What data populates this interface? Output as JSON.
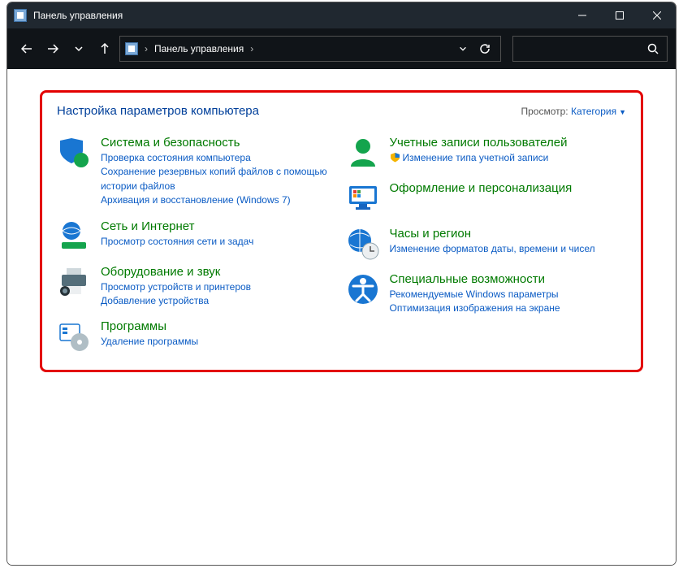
{
  "titlebar": {
    "title": "Панель управления"
  },
  "breadcrumb": {
    "root": "Панель управления"
  },
  "panel": {
    "title": "Настройка параметров компьютера",
    "view_label": "Просмотр:",
    "view_value": "Категория"
  },
  "left": [
    {
      "title": "Система и безопасность",
      "links": [
        "Проверка состояния компьютера",
        "Сохранение резервных копий файлов с помощью истории файлов",
        "Архивация и восстановление (Windows 7)"
      ]
    },
    {
      "title": "Сеть и Интернет",
      "links": [
        "Просмотр состояния сети и задач"
      ]
    },
    {
      "title": "Оборудование и звук",
      "links": [
        "Просмотр устройств и принтеров",
        "Добавление устройства"
      ]
    },
    {
      "title": "Программы",
      "links": [
        "Удаление программы"
      ]
    }
  ],
  "right": [
    {
      "title": "Учетные записи пользователей",
      "links": [
        "Изменение типа учетной записи"
      ],
      "shield": true
    },
    {
      "title": "Оформление и персонализация",
      "links": []
    },
    {
      "title": "Часы и регион",
      "links": [
        "Изменение форматов даты, времени и чисел"
      ]
    },
    {
      "title": "Специальные возможности",
      "links": [
        "Рекомендуемые Windows параметры",
        "Оптимизация изображения на экране"
      ]
    }
  ]
}
